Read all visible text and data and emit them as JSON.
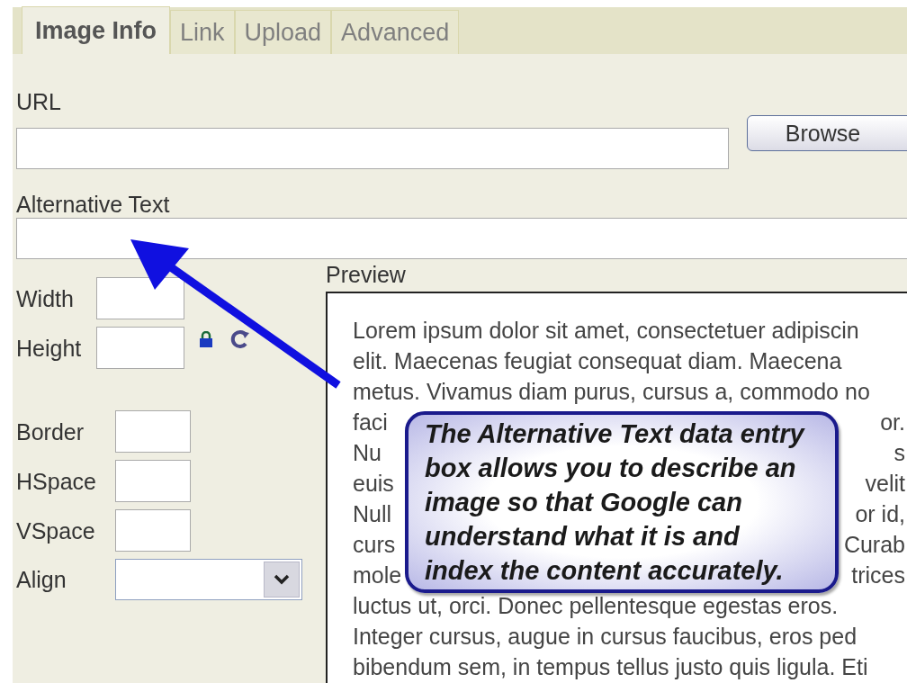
{
  "tabs": [
    {
      "label": "Image Info",
      "selected": true
    },
    {
      "label": "Link",
      "selected": false
    },
    {
      "label": "Upload",
      "selected": false
    },
    {
      "label": "Advanced",
      "selected": false
    }
  ],
  "url": {
    "label": "URL",
    "button": "Browse"
  },
  "alt_text": {
    "label": "Alternative Text"
  },
  "size_fields": [
    {
      "label": "Width"
    },
    {
      "label": "Height"
    }
  ],
  "spacing_fields": [
    {
      "label": "Border"
    },
    {
      "label": "HSpace"
    },
    {
      "label": "VSpace"
    }
  ],
  "align": {
    "label": "Align"
  },
  "preview": {
    "label": "Preview",
    "lines": [
      {
        "text": "Lorem ipsum dolor sit amet, consectetuer adipiscin"
      },
      {
        "text": "elit. Maecenas feugiat consequat diam. Maecena"
      },
      {
        "text": "metus. Vivamus diam purus, cursus a, commodo no"
      },
      {
        "left": "faci",
        "right": "or."
      },
      {
        "left": "Nu",
        "right": "s"
      },
      {
        "left": "euis",
        "right": "velit"
      },
      {
        "left": "Null",
        "right": "or id,"
      },
      {
        "left": "curs",
        "right": "Curab"
      },
      {
        "left": "mole",
        "right": "trices"
      },
      {
        "text": "luctus ut, orci. Donec pellentesque egestas eros."
      },
      {
        "text": "Integer cursus, augue in cursus faucibus, eros ped"
      },
      {
        "text": "bibendum sem, in tempus tellus justo quis ligula. Eti"
      }
    ]
  },
  "callout": {
    "text": "The Alternative Text data entry box allows you to describe an image so that Google can understand what it is and index the content accurately."
  }
}
